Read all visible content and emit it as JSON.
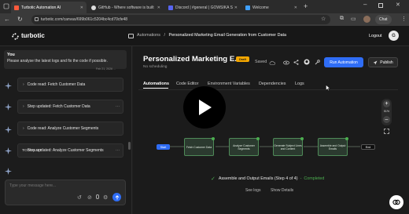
{
  "browser": {
    "tabs": [
      {
        "label": "Turbotic Automation AI",
        "active": true
      },
      {
        "label": "GitHub - Where software is built",
        "active": false
      },
      {
        "label": "Discord | #general | GOWSIKA S",
        "active": false
      },
      {
        "label": "Welcome",
        "active": false
      }
    ],
    "url": "turbotic.com/canvas/699b061c5204bc4cd70cfe48",
    "chat_label": "Chat"
  },
  "header": {
    "logo": "turbotic",
    "breadcrumb_root": "Automations",
    "breadcrumb_sep": "/",
    "breadcrumb_current": "Personalized Marketing Email Generation from Customer Data",
    "logout": "Logout",
    "avatar": "G"
  },
  "chat": {
    "user_name": "You",
    "user_message": "Please analyse the latest logs and fix the code if possible.",
    "timestamp": "Feb 21, 2026 ...",
    "items": [
      {
        "label": "Code read: Fetch Customer Data"
      },
      {
        "label": "Step updated: Fetch Customer Data"
      },
      {
        "label": "Code read: Analyze Customer Segments"
      },
      {
        "label": "Step updated: Analyze Customer Segments"
      }
    ],
    "partial_label": "TODO LIST",
    "input_placeholder": "Type your message here..."
  },
  "automation": {
    "title": "Personalized Marketing E...",
    "status": "Draft",
    "saved": "Saved",
    "schedule": "No scheduling",
    "run_button": "Run Automation",
    "publish_button": "Publish",
    "tabs": [
      "Automations",
      "Code Editor",
      "Environment Variables",
      "Dependencies",
      "Logs"
    ],
    "zoom": "51%",
    "start_label": "Start",
    "end_label": "End",
    "steps": [
      {
        "label": "Fetch Customer Data"
      },
      {
        "label": "Analyze Customer Segments"
      },
      {
        "label": "Generate Subject Lines and Content"
      },
      {
        "label": "Assemble and Output Emails"
      }
    ],
    "run_status_step": "Assemble and Output Emails (Step 4 of 4)",
    "run_status_dash": "-",
    "run_status_result": "Completed",
    "see_logs": "See logs",
    "show_details": "Show Details"
  },
  "colors": {
    "accent": "#2f6df6",
    "success": "#4caf50",
    "draft_badge": "#f4a700",
    "publish_bg": "#2a2a2a",
    "error_dot": "#e53935"
  },
  "icons": [
    "play-icon",
    "send-icon",
    "mic-icon",
    "attach-icon",
    "gear-icon",
    "share-icon",
    "github-icon",
    "zoom-in-icon",
    "zoom-out-icon",
    "expand-icon",
    "support-icon",
    "check-icon",
    "sparkle-icon"
  ]
}
